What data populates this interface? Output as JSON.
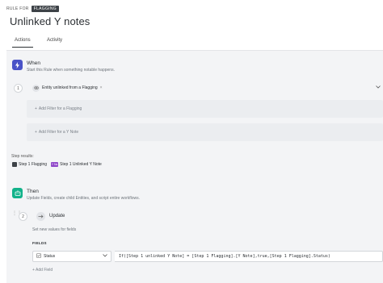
{
  "breadcrumb": {
    "prefix": "RULE FOR",
    "tag": "FLAGGING"
  },
  "page": {
    "title": "Unlinked Y notes"
  },
  "tabs": [
    {
      "label": "Actions",
      "active": true
    },
    {
      "label": "Activity",
      "active": false
    }
  ],
  "when": {
    "title": "When",
    "subtitle": "Start this Rule when something notable happens.",
    "step_number": "1",
    "trigger_label": "Entity unlinked from a Flagging",
    "filters": [
      {
        "label": "Add Filter for a Flagging"
      },
      {
        "label": "Add Filter for a Y Note"
      }
    ]
  },
  "results": {
    "label": "Step results:",
    "chips": [
      {
        "label": "Step 1 Flagging",
        "icon": "flag-icon",
        "color": "#3d4247"
      },
      {
        "label": "Step 1 Unlinked Y Note",
        "icon": "note-badge",
        "badge": "Y Ns",
        "color": "#8f46c9"
      }
    ]
  },
  "then": {
    "title": "Then",
    "subtitle": "Update Fields, create child Entities, and script entire workflows.",
    "step_number": "2",
    "action_title": "Update",
    "action_subtitle": "Set new values for fields",
    "fields_label": "FIELDS",
    "field_name": "Status",
    "formula": "If([Step 1 unlinked Y Note] = [Step 1 Flagging].[Y Note],true,[Step 1 Flagging].Status)",
    "add_field_label": "Add Field"
  },
  "colors": {
    "when_accent": "#4a53c7",
    "then_accent": "#12b28a",
    "panel_bg": "#f3f4f6"
  }
}
